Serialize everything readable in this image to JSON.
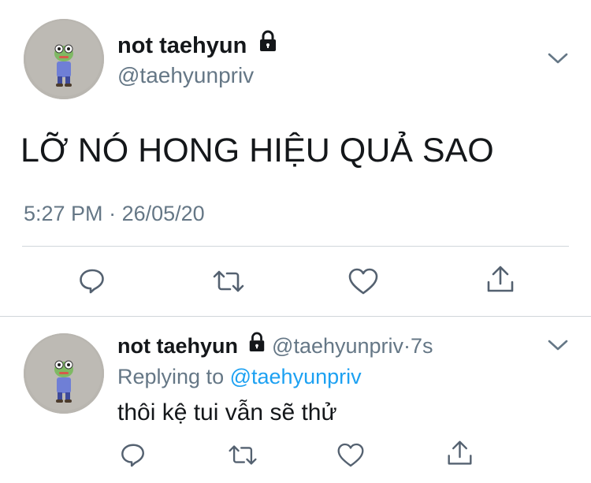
{
  "main_tweet": {
    "display_name": "not taehyun",
    "handle": "@taehyunpriv",
    "text": "LỠ NÓ HONG HIỆU QUẢ SAO",
    "time": "5:27 PM",
    "separator": "·",
    "date": "26/05/20",
    "icons": {
      "lock": "lock-icon",
      "more": "chevron-down-icon",
      "reply": "reply-icon",
      "retweet": "retweet-icon",
      "like": "heart-icon",
      "share": "share-icon"
    }
  },
  "reply_tweet": {
    "display_name": "not taehyun",
    "handle": "@taehyunpriv",
    "dot": "·",
    "age": "7s",
    "replying_prefix": "Replying to",
    "replying_to": "@taehyunpriv",
    "text": "thôi kệ tui vẫn sẽ thử"
  },
  "colors": {
    "text": "#14171a",
    "muted": "#657786",
    "link": "#1da1f2",
    "divider": "#d0d6da",
    "icon": "#546170",
    "avatar_bg": "#b9b6b0",
    "figure_green": "#7fb964",
    "figure_blue": "#6f7fd6"
  }
}
